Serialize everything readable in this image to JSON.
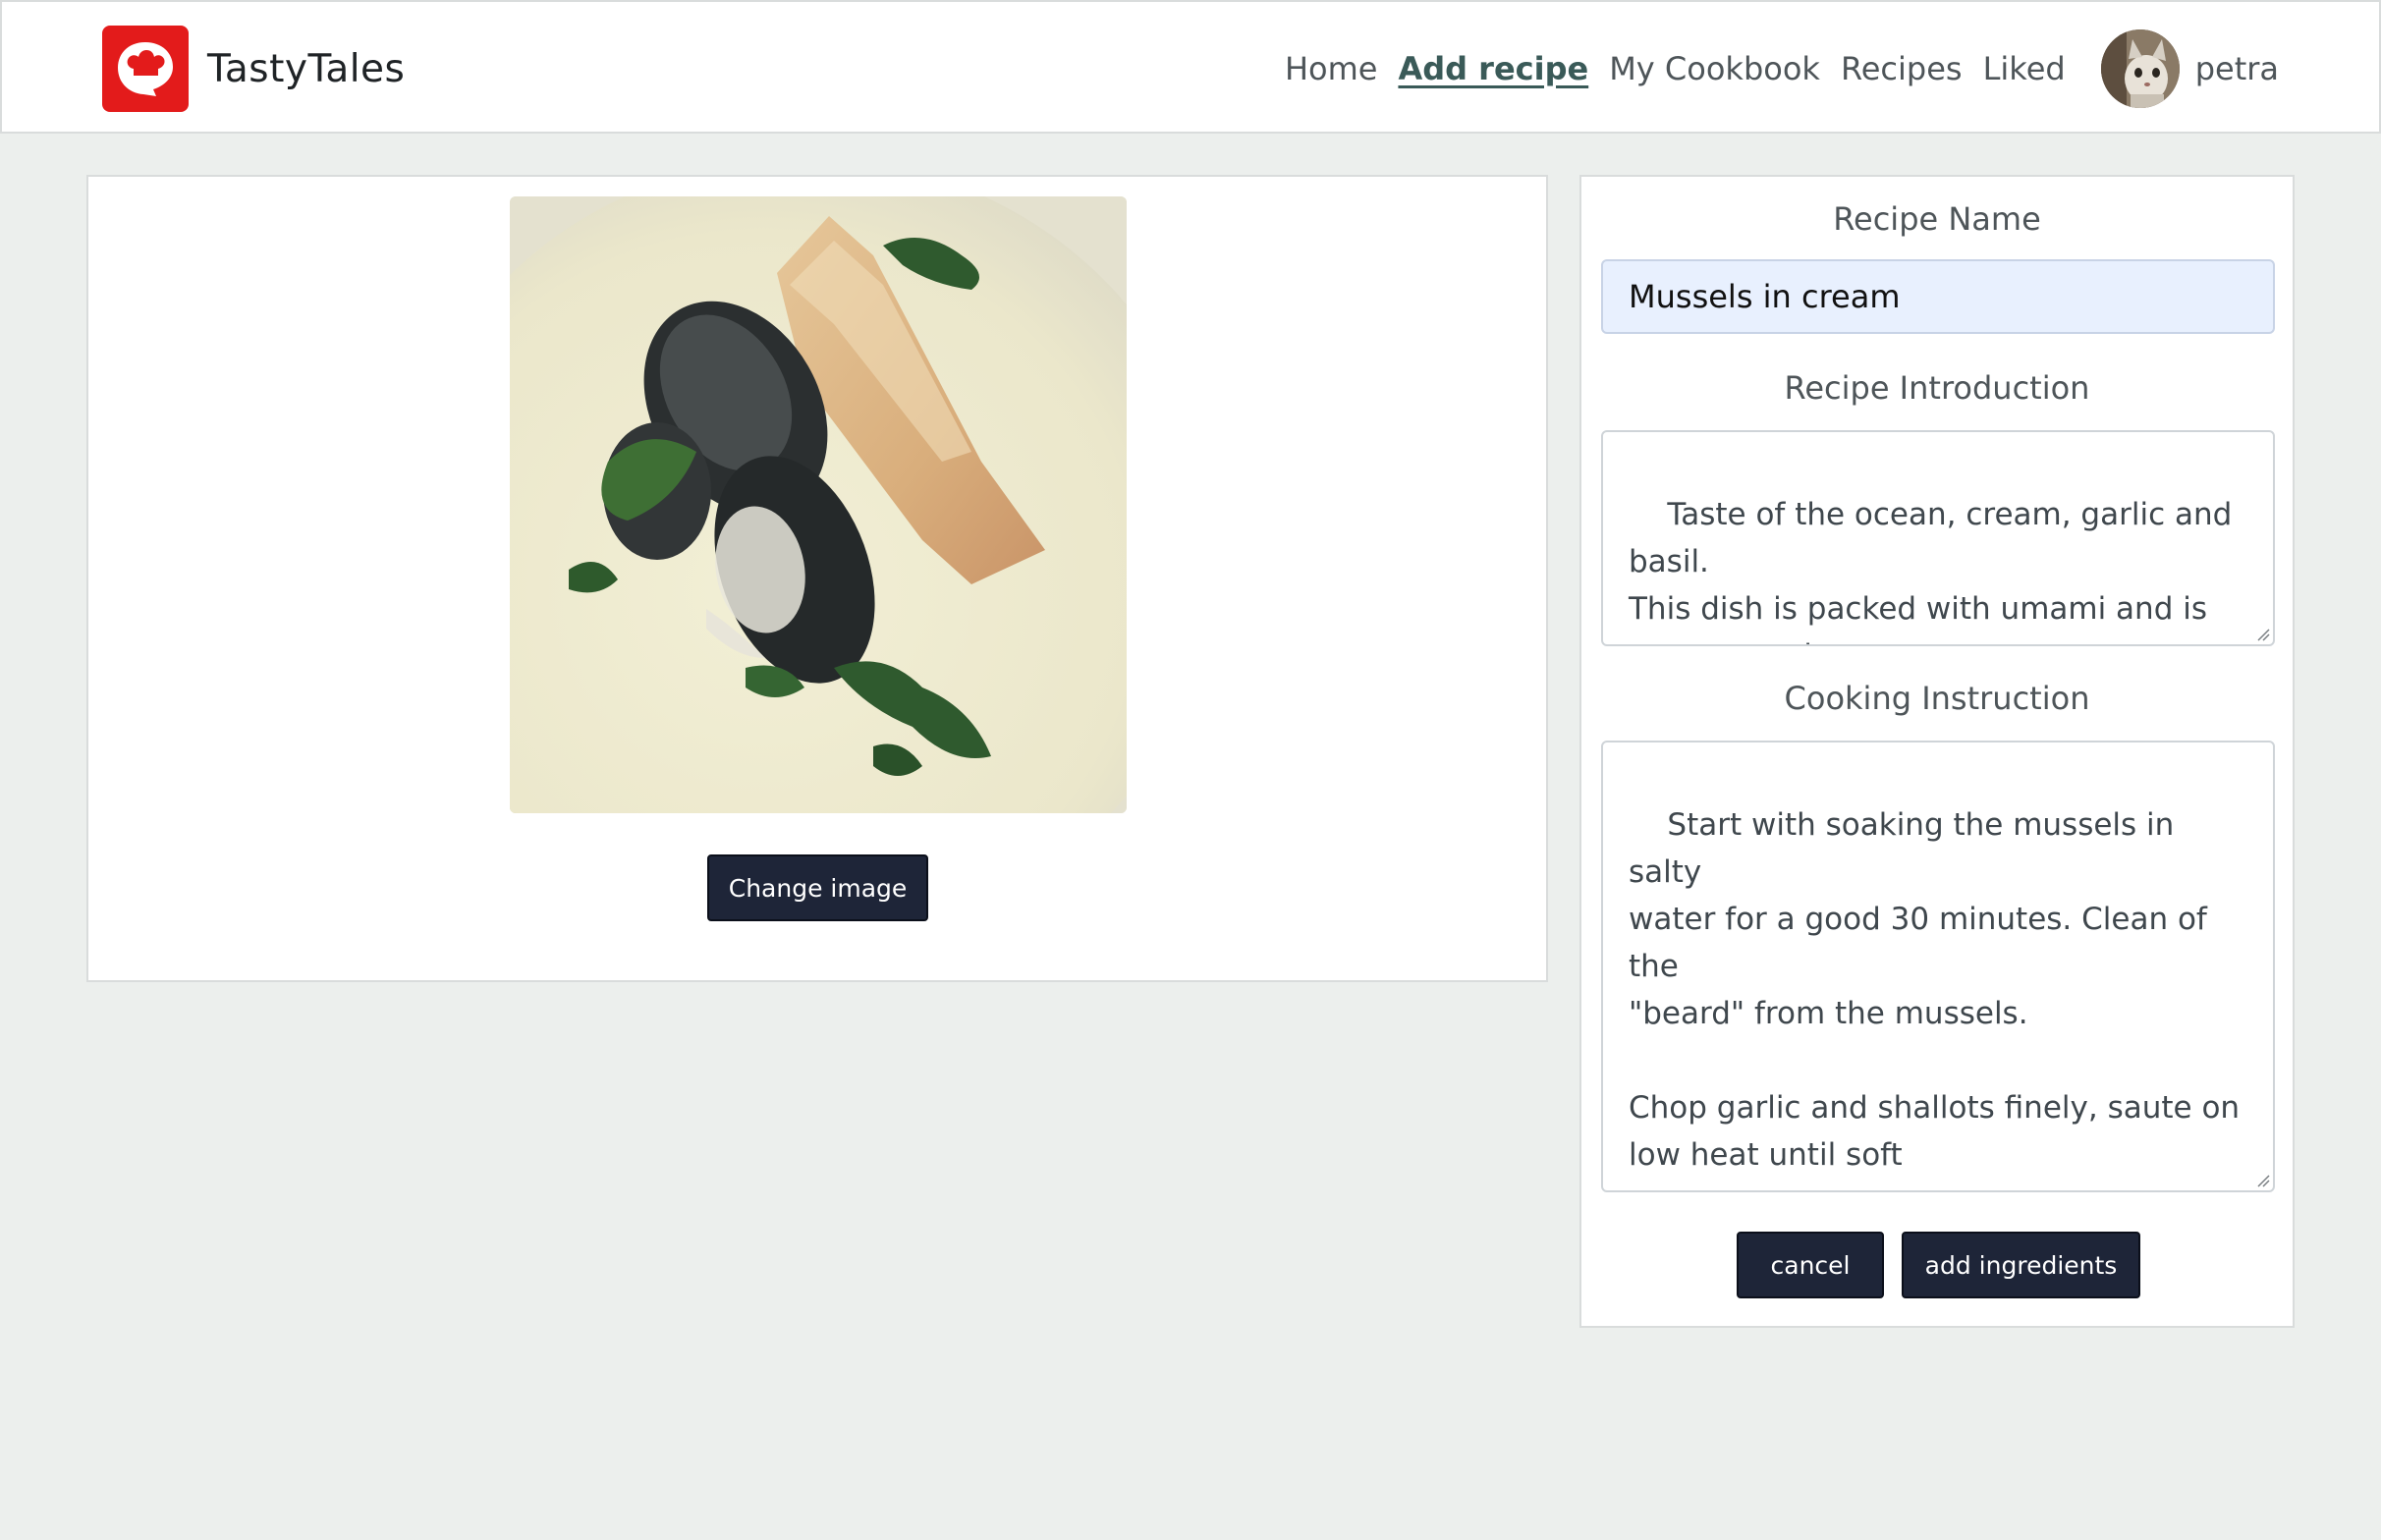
{
  "brand": {
    "name": "TastyTales",
    "logo_icon": "chef-hat-icon",
    "logo_color": "#e31b1b"
  },
  "nav": {
    "links": [
      "Home",
      "Add recipe",
      "My Cookbook",
      "Recipes",
      "Liked"
    ],
    "active": "Add recipe",
    "username": "petra"
  },
  "image_panel": {
    "image": "mussels-dish-image",
    "change_button": "Change image"
  },
  "form": {
    "name_label": "Recipe Name",
    "name_value": "Mussels in cream",
    "intro_label": "Recipe Introduction",
    "intro_value": "Taste of the ocean, cream, garlic and\nbasil.\nThis dish is packed with umami and is\neasy to cook",
    "instruction_label": "Cooking Instruction",
    "instruction_value": "Start with soaking the mussels in salty\nwater for a good 30 minutes. Clean of the\n\"beard\" from the mussels.\n\nChop garlic and shallots finely, saute on\nlow heat until soft",
    "cancel_label": "cancel",
    "add_ingredients_label": "add ingredients"
  },
  "colors": {
    "button": "#1e2538",
    "page_bg": "#ecefed",
    "active_link": "#3a5a58"
  }
}
